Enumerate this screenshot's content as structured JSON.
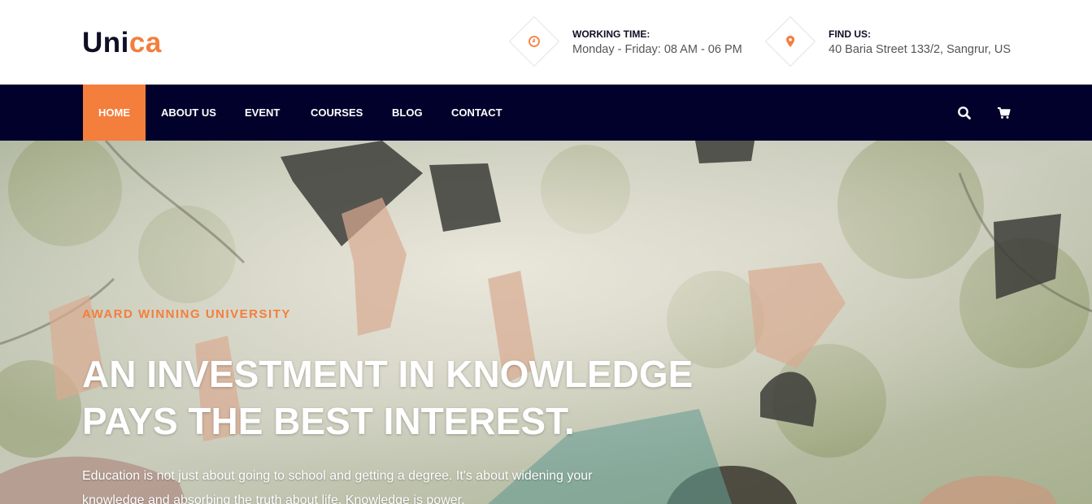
{
  "brand": {
    "part1": "Uni",
    "part2": "ca"
  },
  "header": {
    "working_time": {
      "icon": "clock-icon",
      "label": "WORKING TIME:",
      "value": "Monday - Friday: 08 AM - 06 PM"
    },
    "find_us": {
      "icon": "map-pin-icon",
      "label": "FIND US:",
      "value": "40 Baria Street 133/2, Sangrur, US"
    }
  },
  "nav": {
    "items": [
      {
        "label": "HOME",
        "active": true
      },
      {
        "label": "ABOUT US"
      },
      {
        "label": "EVENT"
      },
      {
        "label": "COURSES"
      },
      {
        "label": "BLOG"
      },
      {
        "label": "CONTACT"
      }
    ],
    "icons": [
      "search-icon",
      "cart-icon"
    ]
  },
  "hero": {
    "tagline": "AWARD WINNING UNIVERSITY",
    "title_line1": "AN INVESTMENT IN KNOWLEDGE",
    "title_line2": "PAYS THE BEST INTEREST.",
    "text": "Education is not just about going to school and getting a degree. It's about widening your knowledge and absorbing the truth about life. Knowledge is power."
  },
  "colors": {
    "accent": "#f47e3c",
    "navy": "#02012c",
    "dark_text": "#0e0e25"
  }
}
